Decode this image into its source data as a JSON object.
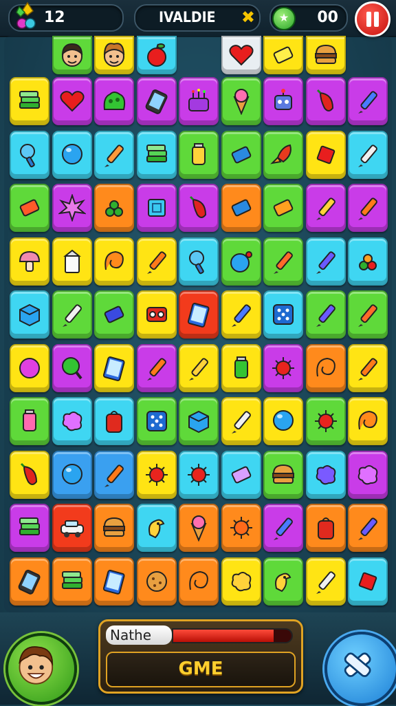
{
  "hud": {
    "score": "12",
    "title": "IVALDIE",
    "coins": "00"
  },
  "bottom_panel": {
    "player_name": "Nathe",
    "health_fraction": 0.85,
    "button_label": "GME"
  },
  "colors": {
    "green": "#5fd93a",
    "magenta": "#c93ce8",
    "cyan": "#3fd6f2",
    "yellow": "#ffe414",
    "orange": "#ff8a1c",
    "red": "#f23b1c",
    "blue": "#3aa0f0",
    "purple": "#8a5cf0",
    "lightgray": "#e8eef2"
  },
  "board": {
    "top_row": [
      {
        "color": "green",
        "icon": "boy-face-icon"
      },
      {
        "color": "yellow",
        "icon": "curly-boy-face-icon"
      },
      {
        "color": "cyan",
        "icon": "apple-icon"
      },
      {
        "color": "none",
        "icon": ""
      },
      {
        "color": "lightgray",
        "icon": "heart-icon"
      },
      {
        "color": "yellow",
        "icon": "note-card-icon"
      },
      {
        "color": "yellow",
        "icon": "burger-icon"
      }
    ],
    "rows": [
      [
        {
          "color": "yellow",
          "icon": "cash-stack-icon"
        },
        {
          "color": "magenta",
          "icon": "heart-icon"
        },
        {
          "color": "magenta",
          "icon": "slime-icon"
        },
        {
          "color": "magenta",
          "icon": "phone-icon"
        },
        {
          "color": "magenta",
          "icon": "pincushion-icon"
        },
        {
          "color": "green",
          "icon": "ice-cream-cone-icon"
        },
        {
          "color": "magenta",
          "icon": "robot-icon"
        },
        {
          "color": "magenta",
          "icon": "chili-icon"
        },
        {
          "color": "magenta",
          "icon": "pen-icon"
        }
      ],
      [
        {
          "color": "cyan",
          "icon": "magnifier-icon"
        },
        {
          "color": "cyan",
          "icon": "balloon-icon"
        },
        {
          "color": "cyan",
          "icon": "pencil-icon"
        },
        {
          "color": "cyan",
          "icon": "books-icon"
        },
        {
          "color": "green",
          "icon": "battery-icon"
        },
        {
          "color": "green",
          "icon": "eraser-icon"
        },
        {
          "color": "green",
          "icon": "rocket-icon"
        },
        {
          "color": "yellow",
          "icon": "red-gem-icon"
        },
        {
          "color": "cyan",
          "icon": "brush-icon"
        }
      ],
      [
        {
          "color": "green",
          "icon": "brick-icon"
        },
        {
          "color": "magenta",
          "icon": "burst-icon"
        },
        {
          "color": "orange",
          "icon": "grapes-icon"
        },
        {
          "color": "magenta",
          "icon": "puzzle-icon"
        },
        {
          "color": "magenta",
          "icon": "chili-icon"
        },
        {
          "color": "orange",
          "icon": "eraser-icon"
        },
        {
          "color": "green",
          "icon": "card-icon"
        },
        {
          "color": "magenta",
          "icon": "bottle-icon"
        },
        {
          "color": "magenta",
          "icon": "carrot-icon"
        }
      ],
      [
        {
          "color": "yellow",
          "icon": "mushroom-icon"
        },
        {
          "color": "yellow",
          "icon": "milk-carton-icon"
        },
        {
          "color": "yellow",
          "icon": "swirl-icon"
        },
        {
          "color": "yellow",
          "icon": "carrot-icon"
        },
        {
          "color": "cyan",
          "icon": "magnifier-icon"
        },
        {
          "color": "green",
          "icon": "bomb-icon"
        },
        {
          "color": "green",
          "icon": "marker-icon"
        },
        {
          "color": "cyan",
          "icon": "crayon-icon"
        },
        {
          "color": "cyan",
          "icon": "fruit-pile-icon"
        }
      ],
      [
        {
          "color": "cyan",
          "icon": "cube-icon"
        },
        {
          "color": "green",
          "icon": "brush-icon"
        },
        {
          "color": "green",
          "icon": "candy-bar-icon"
        },
        {
          "color": "yellow",
          "icon": "toy-robot-icon"
        },
        {
          "color": "red",
          "icon": "tablet-icon"
        },
        {
          "color": "yellow",
          "icon": "pen-icon"
        },
        {
          "color": "cyan",
          "icon": "dice-icon"
        },
        {
          "color": "green",
          "icon": "crayon-icon"
        },
        {
          "color": "green",
          "icon": "marker-icon"
        }
      ],
      [
        {
          "color": "yellow",
          "icon": "ball-icon"
        },
        {
          "color": "magenta",
          "icon": "lollipop-icon"
        },
        {
          "color": "yellow",
          "icon": "tablet-icon"
        },
        {
          "color": "magenta",
          "icon": "carrot-icon"
        },
        {
          "color": "yellow",
          "icon": "bottle-icon"
        },
        {
          "color": "yellow",
          "icon": "jar-icon"
        },
        {
          "color": "magenta",
          "icon": "virus-icon"
        },
        {
          "color": "orange",
          "icon": "swirl-icon"
        },
        {
          "color": "yellow",
          "icon": "carrot-icon"
        }
      ],
      [
        {
          "color": "green",
          "icon": "cup-icon"
        },
        {
          "color": "cyan",
          "icon": "blob-icon"
        },
        {
          "color": "cyan",
          "icon": "backpack-icon"
        },
        {
          "color": "green",
          "icon": "dice-icon"
        },
        {
          "color": "green",
          "icon": "cube-icon"
        },
        {
          "color": "yellow",
          "icon": "brush-icon"
        },
        {
          "color": "yellow",
          "icon": "balloon-icon"
        },
        {
          "color": "green",
          "icon": "virus-icon"
        },
        {
          "color": "yellow",
          "icon": "swirl-icon"
        }
      ],
      [
        {
          "color": "yellow",
          "icon": "chili-icon"
        },
        {
          "color": "blue",
          "icon": "balloon-icon"
        },
        {
          "color": "blue",
          "icon": "carrot-icon"
        },
        {
          "color": "yellow",
          "icon": "virus-icon"
        },
        {
          "color": "cyan",
          "icon": "virus-icon"
        },
        {
          "color": "cyan",
          "icon": "soap-icon"
        },
        {
          "color": "green",
          "icon": "burger-icon"
        },
        {
          "color": "cyan",
          "icon": "puzzle-piece-icon"
        },
        {
          "color": "magenta",
          "icon": "blob-icon"
        }
      ],
      [
        {
          "color": "magenta",
          "icon": "book-icon"
        },
        {
          "color": "red",
          "icon": "car-icon"
        },
        {
          "color": "orange",
          "icon": "burger-icon"
        },
        {
          "color": "cyan",
          "icon": "bird-icon"
        },
        {
          "color": "orange",
          "icon": "ice-cream-cone-icon"
        },
        {
          "color": "orange",
          "icon": "sun-icon"
        },
        {
          "color": "magenta",
          "icon": "pen-icon"
        },
        {
          "color": "orange",
          "icon": "backpack-icon"
        },
        {
          "color": "orange",
          "icon": "crayon-icon"
        }
      ],
      [
        {
          "color": "orange",
          "icon": "phone-icon"
        },
        {
          "color": "orange",
          "icon": "book-icon"
        },
        {
          "color": "orange",
          "icon": "tablet-icon"
        },
        {
          "color": "orange",
          "icon": "cookie-icon"
        },
        {
          "color": "orange",
          "icon": "swirl-icon"
        },
        {
          "color": "yellow",
          "icon": "smiley-blob-icon"
        },
        {
          "color": "green",
          "icon": "bird-icon"
        },
        {
          "color": "yellow",
          "icon": "brush-icon"
        },
        {
          "color": "cyan",
          "icon": "red-gem-icon"
        }
      ]
    ]
  }
}
